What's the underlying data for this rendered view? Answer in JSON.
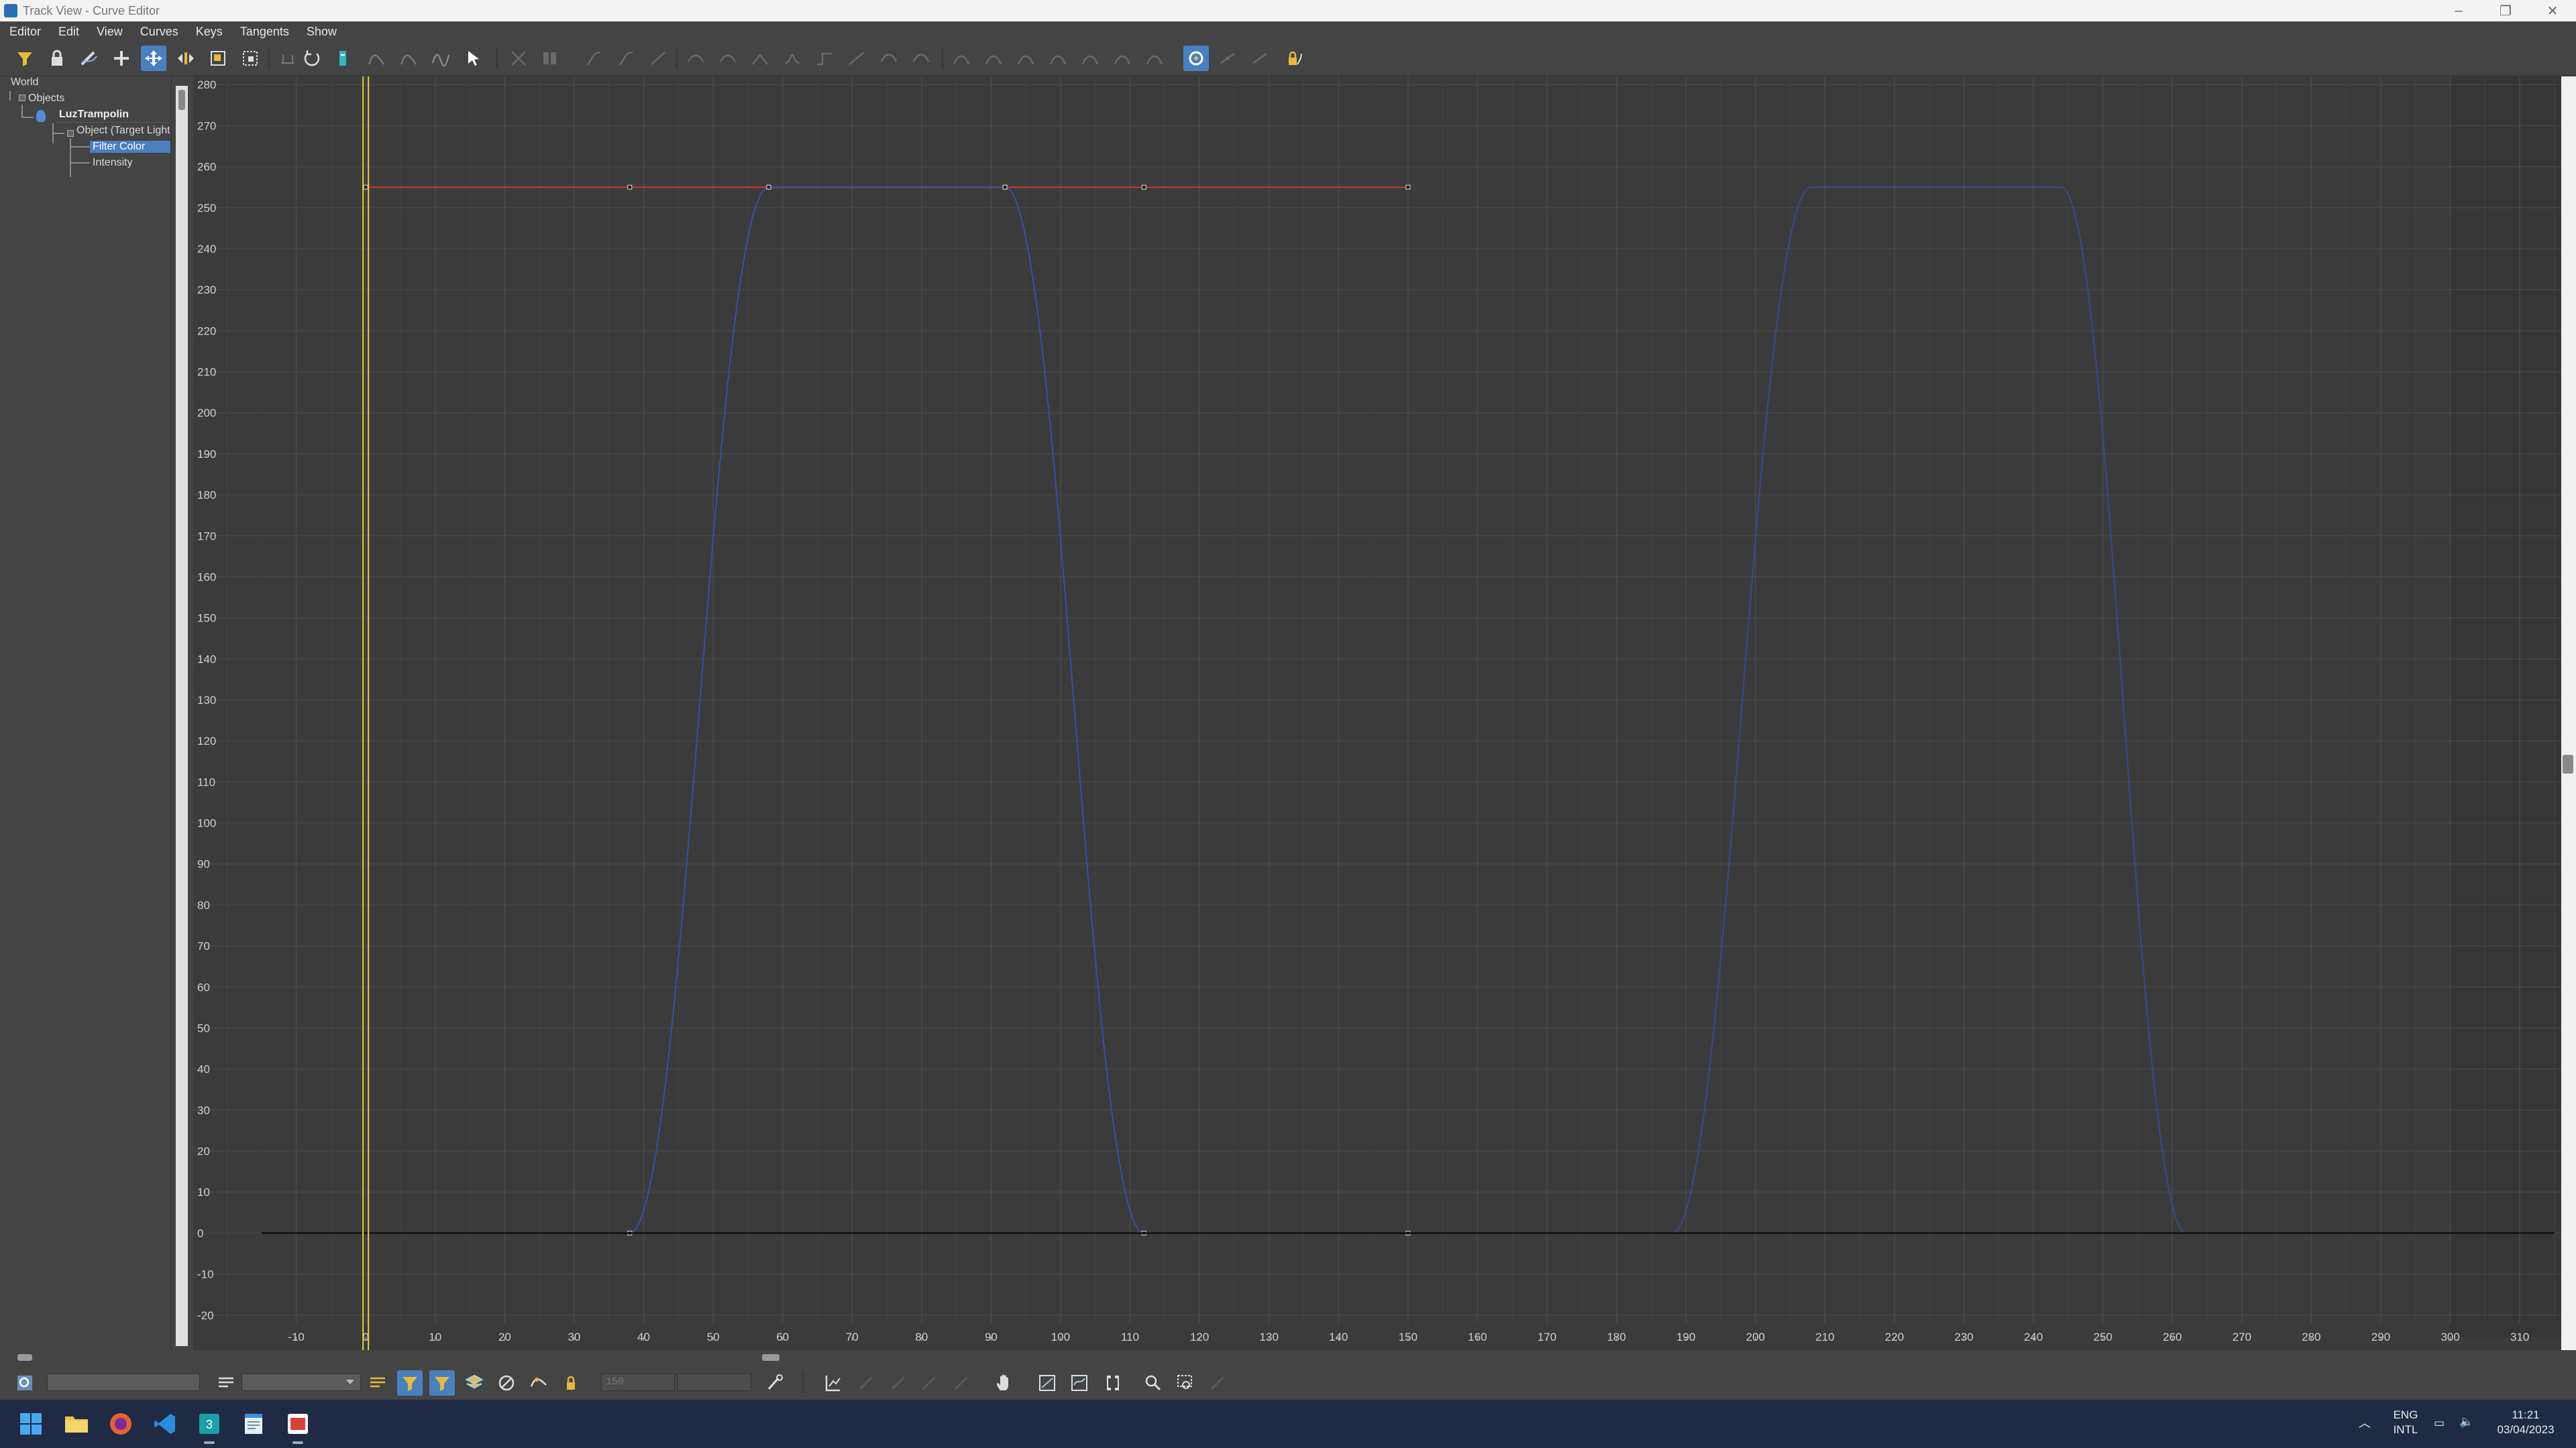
{
  "window": {
    "title": "Track View - Curve Editor"
  },
  "menu": [
    "Editor",
    "Edit",
    "View",
    "Curves",
    "Keys",
    "Tangents",
    "Show"
  ],
  "toolbar": {
    "icons": [
      "filter-icon",
      "lock-selection-icon",
      "draw-curves-icon",
      "add-keys-icon",
      "move-keys-icon",
      "slide-keys-icon",
      "scale-keys-icon",
      "scale-values-icon",
      "snap-icon",
      "reverse-icon",
      "region-icon",
      "retime-icon",
      "curve-tool-icon",
      "soft-select-icon",
      "select-pointer-icon"
    ],
    "active": [
      "move-keys-icon"
    ]
  },
  "tree": {
    "root": "World",
    "objects": "Objects",
    "object_name": "LuzTrampolin",
    "object_type": "Object (Target Light",
    "track_selected": "Filter Color",
    "track_other": "Intensity"
  },
  "chart_data": {
    "type": "line",
    "title": "",
    "xlabel": "",
    "ylabel": "",
    "xlim": [
      -20,
      315
    ],
    "ylim": [
      -22,
      282
    ],
    "x_ticks": [
      -10,
      0,
      10,
      20,
      30,
      40,
      50,
      60,
      70,
      80,
      90,
      100,
      110,
      120,
      130,
      140,
      150,
      160,
      170,
      180,
      190,
      200,
      210,
      220,
      230,
      240,
      250,
      260,
      270,
      280,
      290,
      300,
      310
    ],
    "y_ticks": [
      -20,
      -10,
      0,
      10,
      20,
      30,
      40,
      50,
      60,
      70,
      80,
      90,
      100,
      110,
      120,
      130,
      140,
      150,
      160,
      170,
      180,
      190,
      200,
      210,
      220,
      230,
      240,
      250,
      260,
      270,
      280
    ],
    "grid": true,
    "current_frame": 0,
    "series": [
      {
        "color": "#d23a2a",
        "keys": [
          [
            0,
            255
          ],
          [
            38,
            255
          ],
          [
            58,
            255
          ],
          [
            92,
            255
          ],
          [
            112,
            255
          ],
          [
            150,
            255
          ]
        ]
      },
      {
        "color": "#3a4fa8",
        "keys": [
          [
            38,
            0
          ],
          [
            58,
            255
          ],
          [
            92,
            255
          ],
          [
            112,
            0
          ],
          [
            150,
            0
          ]
        ],
        "repeat_after": [
          [
            188,
            0
          ],
          [
            208,
            255
          ],
          [
            244,
            255
          ],
          [
            262,
            0
          ],
          [
            310,
            0
          ]
        ]
      },
      {
        "color": "#111111",
        "keys": [
          [
            -15,
            0
          ],
          [
            315,
            0
          ]
        ]
      }
    ]
  },
  "status": {
    "frame_field": "150"
  },
  "taskbar": {
    "language_top": "ENG",
    "language_bottom": "INTL",
    "time": "11:21",
    "date": "03/04/2023"
  }
}
